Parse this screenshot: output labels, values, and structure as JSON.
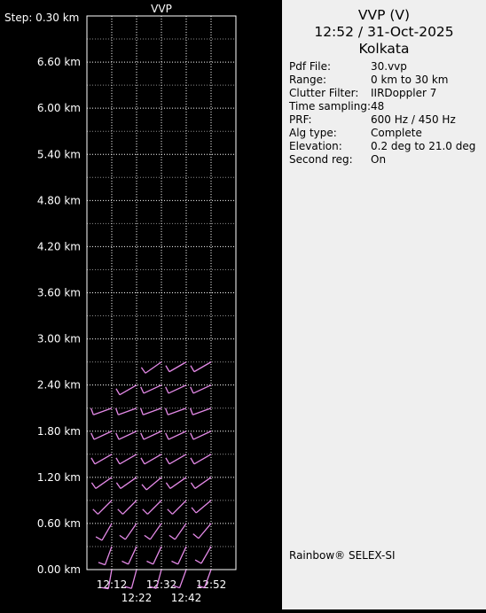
{
  "plot": {
    "title": "VVP",
    "step_label": "Step: 0.30 km"
  },
  "info": {
    "title": "VVP (V)",
    "datetime": "12:52 / 31-Oct-2025",
    "location": "Kolkata",
    "fields": [
      {
        "label": "Pdf File:",
        "value": "30.vvp"
      },
      {
        "label": "Range:",
        "value": "0 km to 30 km"
      },
      {
        "label": "Clutter Filter:",
        "value": "IIRDoppler 7"
      },
      {
        "label": "Time sampling:",
        "value": "48"
      },
      {
        "label": "PRF:",
        "value": "600 Hz / 450 Hz"
      },
      {
        "label": "Alg type:",
        "value": "Complete"
      },
      {
        "label": "Elevation:",
        "value": "0.2 deg to 21.0 deg"
      },
      {
        "label": "Second reg:",
        "value": "On"
      }
    ],
    "footer": "Rainbow® SELEX-SI"
  },
  "colors": {
    "barb": "#e58ae8",
    "grid": "#ffffff",
    "background": "#000000",
    "panel": "#efefef"
  },
  "chart_data": {
    "type": "wind-barb time-height",
    "title": "VVP",
    "ylabel": "",
    "xlabel": "",
    "y_ticks": [
      "0.00 km",
      "0.60 km",
      "1.20 km",
      "1.80 km",
      "2.40 km",
      "3.00 km",
      "3.60 km",
      "4.20 km",
      "4.80 km",
      "5.40 km",
      "6.00 km",
      "6.60 km"
    ],
    "x_ticks_row1": [
      "12:12",
      "12:32",
      "12:52"
    ],
    "x_ticks_row2": [
      "12:22",
      "12:42"
    ],
    "times": [
      "12:12",
      "12:22",
      "12:32",
      "12:42",
      "12:52"
    ],
    "heights_km": [
      0.0,
      0.3,
      0.6,
      0.9,
      1.2,
      1.5,
      1.8,
      2.1,
      2.4,
      2.7
    ],
    "ylim_km": [
      0.0,
      7.2
    ],
    "grid": true,
    "barbs": [
      {
        "time": "12:12",
        "heights_km": [
          0.0,
          0.3,
          0.6,
          0.9,
          1.2,
          1.5,
          1.8,
          2.1
        ],
        "dir_deg": [
          190,
          200,
          210,
          225,
          235,
          240,
          245,
          250
        ]
      },
      {
        "time": "12:22",
        "heights_km": [
          0.0,
          0.3,
          0.6,
          0.9,
          1.2,
          1.5,
          1.8,
          2.1,
          2.4
        ],
        "dir_deg": [
          195,
          205,
          215,
          225,
          235,
          240,
          245,
          250,
          240
        ]
      },
      {
        "time": "12:32",
        "heights_km": [
          0.0,
          0.3,
          0.6,
          0.9,
          1.2,
          1.5,
          1.8,
          2.1,
          2.4,
          2.7
        ],
        "dir_deg": [
          195,
          205,
          215,
          225,
          230,
          240,
          245,
          250,
          245,
          235
        ]
      },
      {
        "time": "12:42",
        "heights_km": [
          0.0,
          0.3,
          0.6,
          0.9,
          1.2,
          1.5,
          1.8,
          2.1,
          2.4,
          2.7
        ],
        "dir_deg": [
          200,
          205,
          215,
          225,
          235,
          240,
          245,
          250,
          245,
          240
        ]
      },
      {
        "time": "12:52",
        "heights_km": [
          0.0,
          0.3,
          0.6,
          0.9,
          1.2,
          1.5,
          1.8,
          2.1,
          2.4,
          2.7
        ],
        "dir_deg": [
          200,
          210,
          220,
          230,
          235,
          240,
          245,
          250,
          245,
          240
        ]
      }
    ]
  }
}
